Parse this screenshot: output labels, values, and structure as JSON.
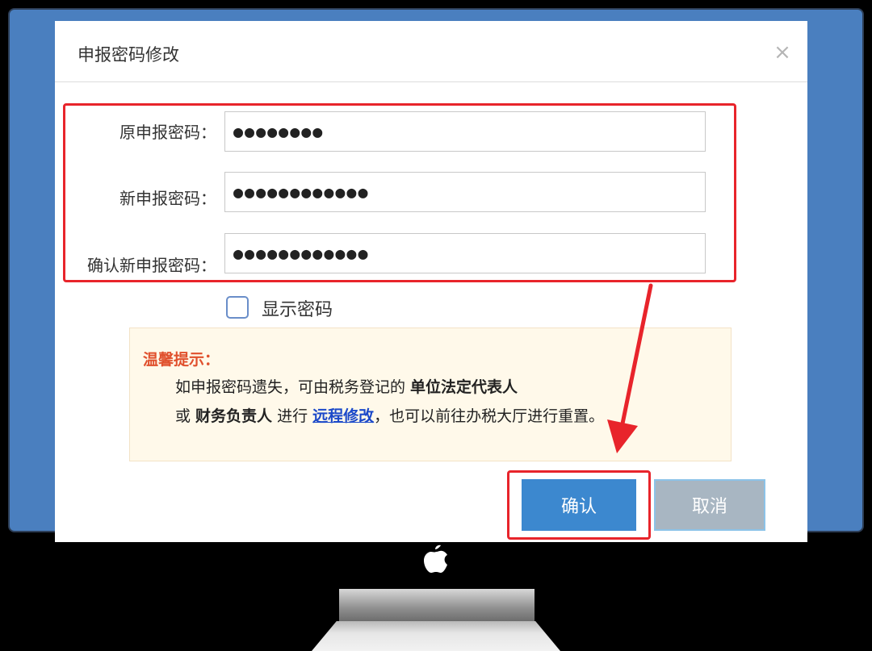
{
  "dialog": {
    "title": "申报密码修改",
    "close_symbol": "×"
  },
  "form": {
    "old_password_label": "原申报密码：",
    "old_password_value": "●●●●●●●●",
    "new_password_label": "新申报密码：",
    "new_password_value": "●●●●●●●●●●●●",
    "confirm_password_label": "确认新申报密码：",
    "confirm_password_value": "●●●●●●●●●●●●"
  },
  "show_password": {
    "label": "显示密码",
    "checked": false
  },
  "tips": {
    "title": "温馨提示：",
    "line1_prefix": "如申报密码遗失，可由税务登记的 ",
    "line1_bold": "单位法定代表人",
    "line2_prefix": "或 ",
    "line2_bold": "财务负责人",
    "line2_middle": " 进行 ",
    "line2_link": "远程修改",
    "line2_suffix": "，也可以前往办税大厅进行重置。"
  },
  "buttons": {
    "confirm": "确认",
    "cancel": "取消"
  },
  "colors": {
    "screen_bg": "#4a7fbf",
    "highlight": "#e8242b",
    "confirm_button": "#3c88cf",
    "cancel_button": "#a8b6c2",
    "tips_title": "#e0502d",
    "link": "#1b49c9"
  }
}
